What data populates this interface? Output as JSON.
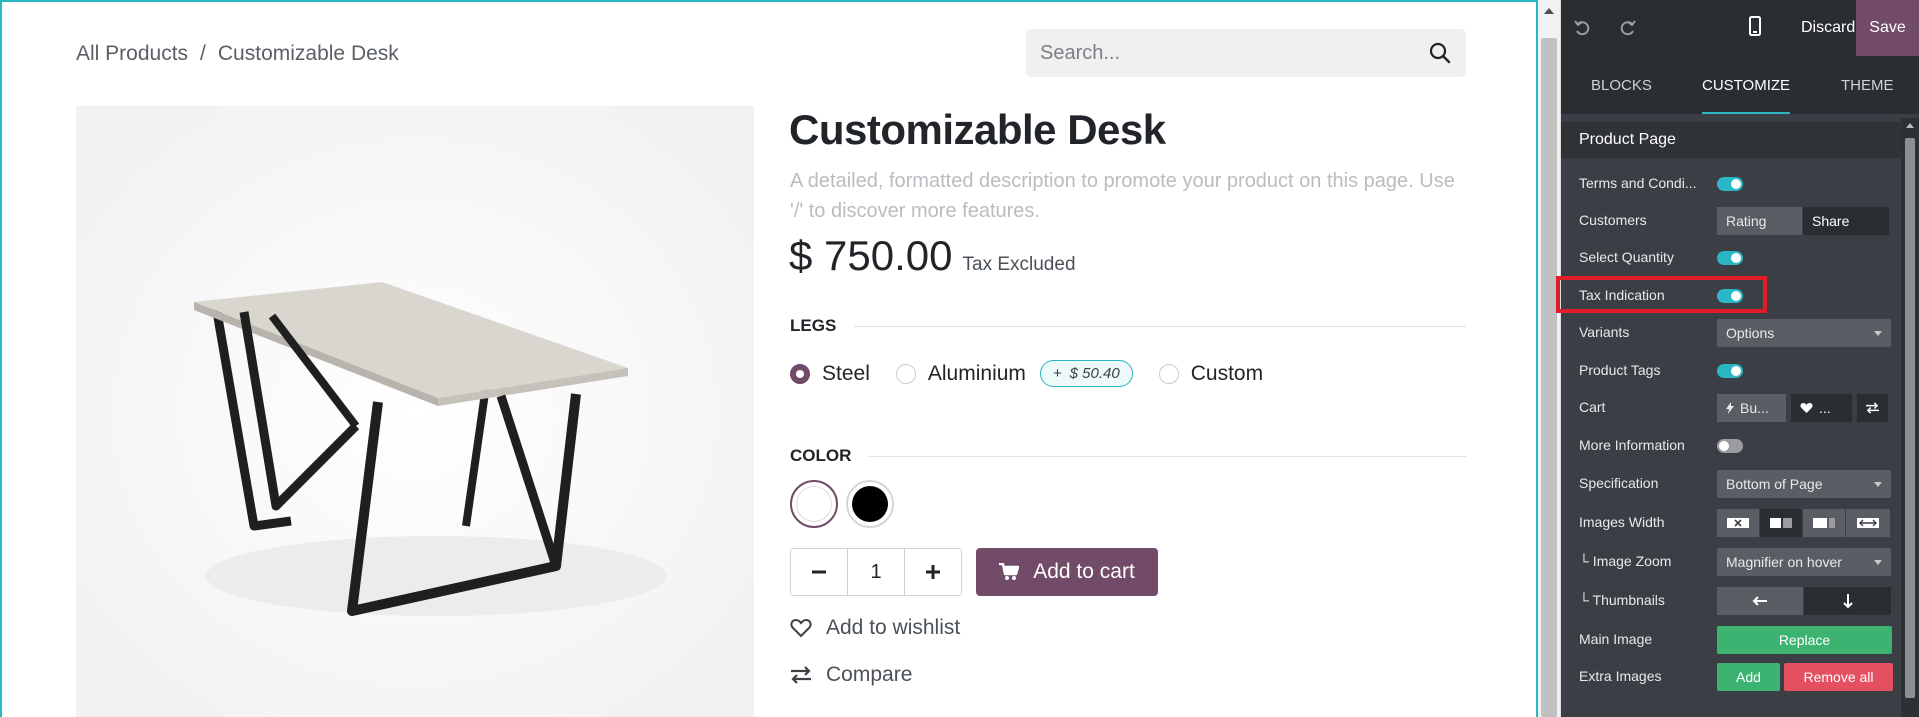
{
  "breadcrumb": {
    "root": "All Products",
    "separator": "/",
    "current": "Customizable Desk"
  },
  "search": {
    "placeholder": "Search..."
  },
  "product": {
    "title": "Customizable Desk",
    "description": "A detailed, formatted description to promote your product on this page. Use '/' to discover more features.",
    "price": "$ 750.00",
    "tax_note": "Tax Excluded",
    "legs_heading": "LEGS",
    "legs_options": [
      {
        "label": "Steel",
        "selected": true
      },
      {
        "label": "Aluminium",
        "selected": false,
        "extra": "$ 50.40",
        "extra_prefix": "+"
      },
      {
        "label": "Custom",
        "selected": false
      }
    ],
    "color_heading": "COLOR",
    "colors": [
      {
        "name": "white",
        "hex": "#ffffff",
        "selected": true
      },
      {
        "name": "black",
        "hex": "#000000",
        "selected": false
      }
    ],
    "quantity": "1",
    "add_to_cart": "Add to cart",
    "wishlist": "Add to wishlist",
    "compare": "Compare"
  },
  "editor": {
    "discard": "Discard",
    "save": "Save",
    "tabs": [
      "BLOCKS",
      "CUSTOMIZE",
      "THEME"
    ],
    "active_tab": "CUSTOMIZE",
    "section": "Product Page",
    "options": {
      "terms": {
        "label": "Terms and Condi...",
        "on": true
      },
      "customers": {
        "label": "Customers",
        "choices": [
          "Rating",
          "Share"
        ]
      },
      "select_quantity": {
        "label": "Select Quantity",
        "on": true
      },
      "tax_indication": {
        "label": "Tax Indication",
        "on": true
      },
      "variants": {
        "label": "Variants",
        "value": "Options"
      },
      "product_tags": {
        "label": "Product Tags",
        "on": true
      },
      "cart": {
        "label": "Cart",
        "choices": [
          "Bu...",
          "..."
        ]
      },
      "more_information": {
        "label": "More Information",
        "on": false
      },
      "specification": {
        "label": "Specification",
        "value": "Bottom of Page"
      },
      "images_width": {
        "label": "Images Width"
      },
      "image_zoom": {
        "label": "└ Image Zoom",
        "value": "Magnifier on hover"
      },
      "thumbnails": {
        "label": "└ Thumbnails"
      },
      "main_image": {
        "label": "Main Image",
        "button": "Replace"
      },
      "extra_images": {
        "label": "Extra Images",
        "add": "Add",
        "remove": "Remove all"
      }
    }
  },
  "colors": {
    "accent": "#2bb6c4",
    "brand": "#714b67",
    "highlight": "#e11d2a"
  }
}
